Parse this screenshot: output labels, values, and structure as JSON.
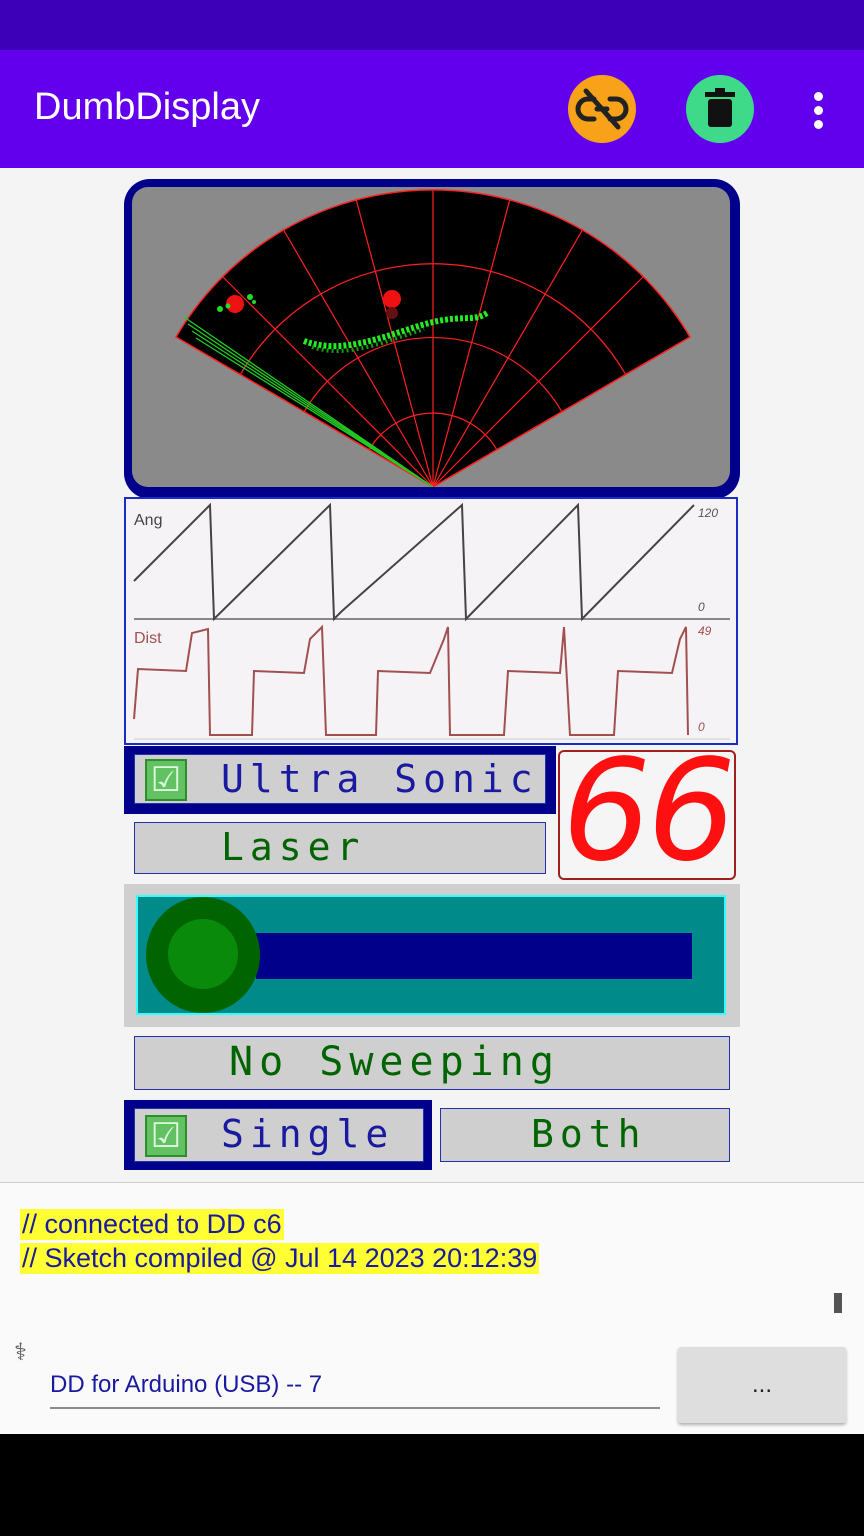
{
  "app": {
    "title": "DumbDisplay"
  },
  "toolbar": {
    "unlink_icon": "link-off-icon",
    "trash_icon": "trash-icon",
    "more_icon": "more-vert-icon"
  },
  "plots": {
    "angle": {
      "label": "Ang",
      "max": "120",
      "min": "0"
    },
    "distance": {
      "label": "Dist",
      "max": "49",
      "min": "0"
    }
  },
  "controls": {
    "ultrasonic_label": "Ultra Sonic",
    "laser_label": "Laser",
    "seven_segment_value": "66",
    "sweep_label": "No Sweeping",
    "single_label": "Single",
    "both_label": "Both",
    "slider_value": 0
  },
  "log": {
    "line1": "// connected to DD c6",
    "line2": "// Sketch compiled @ Jul 14 2023 20:12:39"
  },
  "connection": {
    "label": "DD for Arduino (USB) -- 7",
    "more_button": "..."
  },
  "colors": {
    "appbar": "#6200ee",
    "radar_line": "#ff0000",
    "radar_points": "#00ff00",
    "lcd_text": "#006400"
  }
}
